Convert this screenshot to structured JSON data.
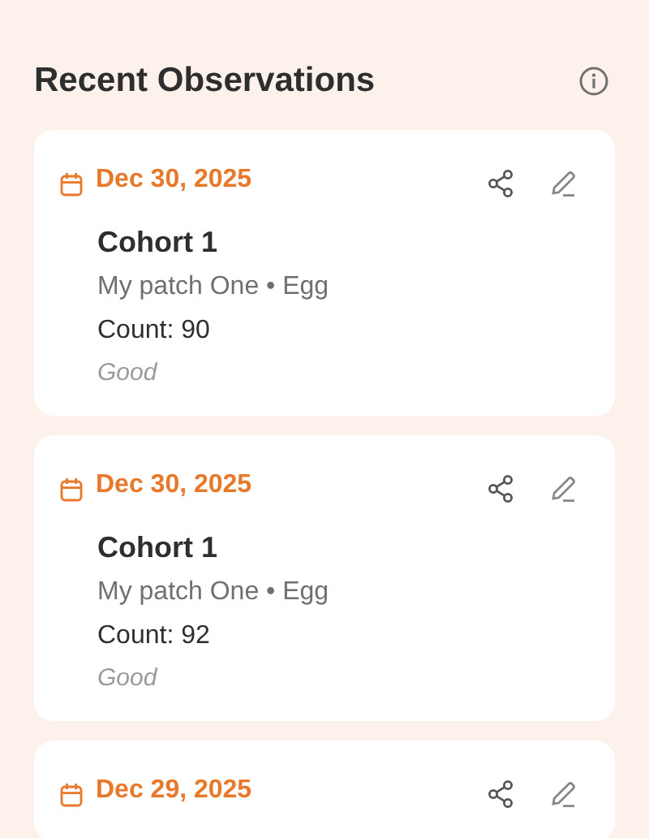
{
  "header": {
    "title": "Recent Observations"
  },
  "observations": [
    {
      "date": "Dec 30, 2025",
      "cohort": "Cohort 1",
      "location": "My patch One • Egg",
      "count": "Count: 90",
      "condition": "Good"
    },
    {
      "date": "Dec 30, 2025",
      "cohort": "Cohort 1",
      "location": "My patch One • Egg",
      "count": "Count: 92",
      "condition": "Good"
    },
    {
      "date": "Dec 29, 2025"
    }
  ]
}
